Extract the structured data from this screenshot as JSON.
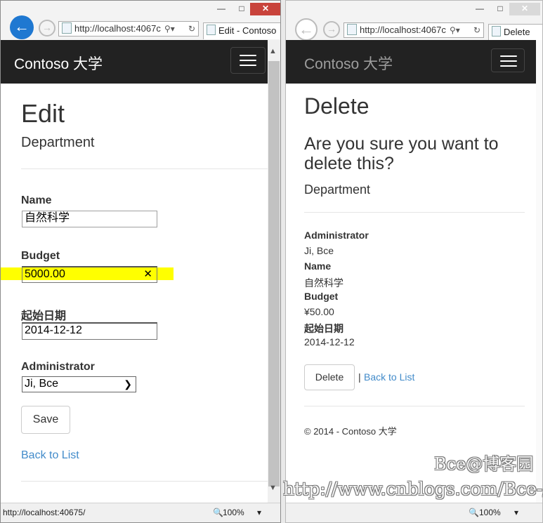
{
  "left_window": {
    "address": "http://localhost:4067с",
    "tab_title": "Edit - Contoso",
    "brand": "Contoso 大学",
    "page_title": "Edit",
    "subtitle": "Department",
    "fields": {
      "name_label": "Name",
      "name_value": "自然科学",
      "budget_label": "Budget",
      "budget_value": "5000.00",
      "start_label": "起始日期",
      "start_value": "2014-12-12",
      "admin_label": "Administrator",
      "admin_value": "Ji, Bce"
    },
    "save_label": "Save",
    "back_link": "Back to List",
    "status_url": "http://localhost:40675/",
    "zoom": "100%"
  },
  "right_window": {
    "address": "http://localhost:4067с",
    "tab_title": "Delete",
    "brand": "Contoso 大学",
    "page_title": "Delete",
    "question": "Are you sure you want to delete this?",
    "subtitle": "Department",
    "details": [
      {
        "term": "Administrator",
        "value": "Ji, Bce"
      },
      {
        "term": "Name",
        "value": "自然科学"
      },
      {
        "term": "Budget",
        "value": "¥50.00"
      },
      {
        "term": "起始日期",
        "value": "2014-12-12"
      }
    ],
    "delete_label": "Delete",
    "separator": "|",
    "back_link": "Back to List",
    "footer": "© 2014 - Contoso 大学",
    "zoom": "100%"
  },
  "watermark": {
    "line1": "Bce@博客园",
    "line2": "http://www.cnblogs.com/Bce-/"
  },
  "colors": {
    "navbar": "#222222",
    "link": "#428bca",
    "highlight": "#ffff00",
    "close_button": "#c8433b",
    "back_button": "#1f78d1"
  }
}
